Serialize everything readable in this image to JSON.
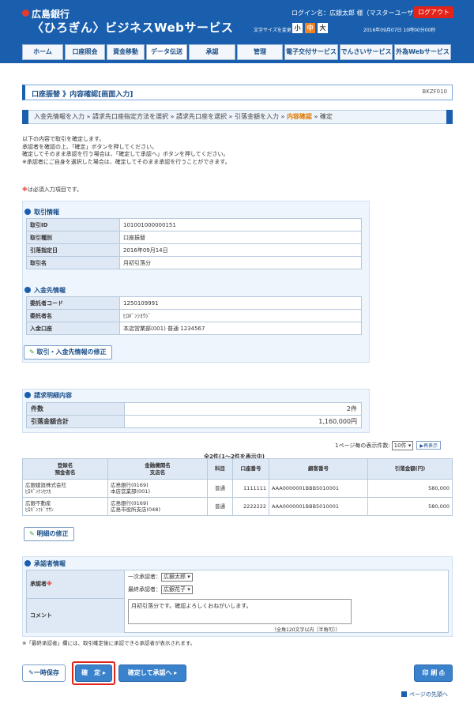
{
  "header": {
    "bank": "広島銀行",
    "service": "〈ひろぎん〉ビジネスWebサービス",
    "login": "ログイン名：広銀太郎 様（マスターユーザ）",
    "logout": "ログアウト",
    "fontsize_label": "文字サイズを変更",
    "fs_small": "小",
    "fs_mid": "中",
    "fs_large": "大",
    "datetime": "2016年09月07日 10時00分00秒"
  },
  "nav": [
    "ホーム",
    "口座照会",
    "資金移動",
    "データ伝送",
    "承認",
    "管理",
    "電子交付サービス",
    "でんさいサービス",
    "外為Webサービス"
  ],
  "page": {
    "title": "口座振替 》内容確認[画面入力]",
    "code": "BKZF010"
  },
  "steps": {
    "s1": "入金先情報を入力",
    "s2": "請求先口座指定方法を選択",
    "s3": "請求先口座を選択",
    "s4": "引落金額を入力",
    "s5": "内容確認",
    "s6": "確定"
  },
  "intro": {
    "l1": "以下の内容で取引を確定します。",
    "l2": "承認者を確認の上、「確定」ボタンを押してください。",
    "l3": "確定してそのまま承認を行う場合は、「確定して承認へ」ボタンを押してください。",
    "l4": "※承認者にご自身を選択した場合は、確定してそのまま承認を行うことができます。"
  },
  "required_note": "は必須入力項目です。",
  "required_mark": "※",
  "tx": {
    "title": "取引情報",
    "rows": [
      {
        "k": "取引ID",
        "v": "101001000000151"
      },
      {
        "k": "取引種別",
        "v": "口座振替"
      },
      {
        "k": "引落指定日",
        "v": "2016年09月14日"
      },
      {
        "k": "取引名",
        "v": "月初引落分"
      }
    ]
  },
  "payee": {
    "title": "入金先情報",
    "rows": [
      {
        "k": "委託者コード",
        "v": "1250109991"
      },
      {
        "k": "委託者名",
        "v": "ﾋﾛｷﾞﾝｼﾖｳｼﾞ"
      },
      {
        "k": "入金口座",
        "v": "本店営業部(001) 普通 1234567"
      }
    ]
  },
  "edit1": "取引・入金先情報の修正",
  "summary": {
    "title": "請求明細内容",
    "count_label": "件数",
    "count": "2件",
    "total_label": "引落金額合計",
    "total": "1,160,000円"
  },
  "pager": {
    "label": "1ページ毎の表示件数:",
    "value": "10件",
    "redisplay": "再表示"
  },
  "table": {
    "count": "全2件(1〜2件を表示中)",
    "headers": {
      "h1a": "登録名",
      "h1b": "預金者名",
      "h2a": "金融機関名",
      "h2b": "支店名",
      "h3": "科目",
      "h4": "口座番号",
      "h5": "顧客番号",
      "h6": "引落金額(円)"
    },
    "rows": [
      {
        "n1": "広銀建設株式会社",
        "n2": "ﾋﾛｷﾞﾝｹﾝｾﾂｶ",
        "b1": "広島銀行(0169)",
        "b2": "本店営業部(001)",
        "type": "普通",
        "acct": "1111111",
        "cust": "AAA0000001BBB5010001",
        "amt": "580,000"
      },
      {
        "n1": "広銀不動産",
        "n2": "ﾋﾛｷﾞﾝﾌﾄﾞｳｻﾝ",
        "b1": "広島銀行(0169)",
        "b2": "広島市役所支店(048)",
        "type": "普通",
        "acct": "2222222",
        "cust": "AAA0000001BBB5010001",
        "amt": "580,000"
      }
    ]
  },
  "edit2": "明細の修正",
  "approver": {
    "title": "承認者情報",
    "label": "承認者",
    "first_label": "一次承認者：",
    "first": "広銀太郎",
    "final_label": "最終承認者：",
    "final": "広銀花子",
    "comment_label": "コメント",
    "comment": "月初引落分です。確認よろしくおねがいします。",
    "limit": "（全角120文字以内［半角可］）"
  },
  "footer_note": "※「最終承認者」欄には、取引確定後に承認できる承認者が表示されます。",
  "buttons": {
    "save": "一時保存",
    "confirm": "確　定",
    "confirm_approve": "確定して承認へ",
    "print": "印 刷"
  },
  "page_top": "ページの先頭へ"
}
